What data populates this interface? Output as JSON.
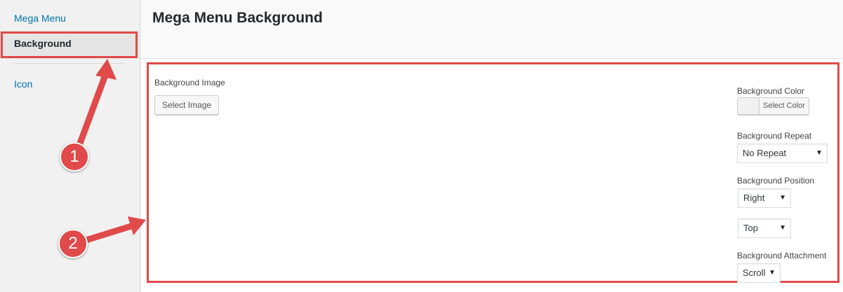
{
  "sidebar": {
    "items": [
      {
        "label": "Mega Menu"
      },
      {
        "label": "Background"
      },
      {
        "label": "Icon"
      }
    ]
  },
  "header": {
    "title": "Mega Menu Background"
  },
  "form": {
    "bg_image": {
      "label": "Background Image",
      "button": "Select Image"
    },
    "bg_color": {
      "label": "Background Color",
      "button": "Select Color"
    },
    "bg_repeat": {
      "label": "Background Repeat",
      "value": "No Repeat"
    },
    "bg_position": {
      "label": "Background Position",
      "horizontal": "Right",
      "vertical": "Top"
    },
    "bg_attachment": {
      "label": "Background Attachment",
      "value": "Scroll"
    }
  },
  "annotations": {
    "callout1": "1",
    "callout2": "2",
    "color": "#e04a4a"
  }
}
